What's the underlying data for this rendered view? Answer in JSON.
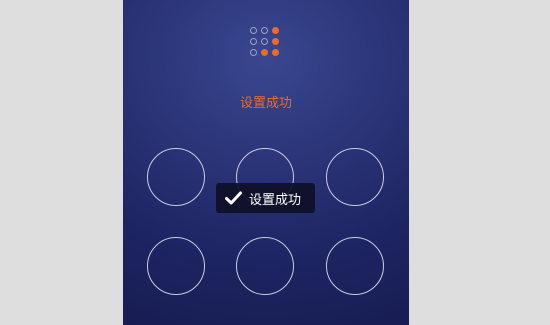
{
  "pattern_preview": {
    "icon": "pattern-preview-icon",
    "grid": [
      [
        false,
        false,
        true
      ],
      [
        false,
        false,
        true
      ],
      [
        false,
        true,
        true
      ]
    ],
    "active_color": "#f06a23"
  },
  "status_text": "设置成功",
  "pattern_nodes": 6,
  "toast": {
    "icon": "check-icon",
    "text": "设置成功"
  },
  "colors": {
    "accent": "#f06a23",
    "background": "#1d2462"
  }
}
